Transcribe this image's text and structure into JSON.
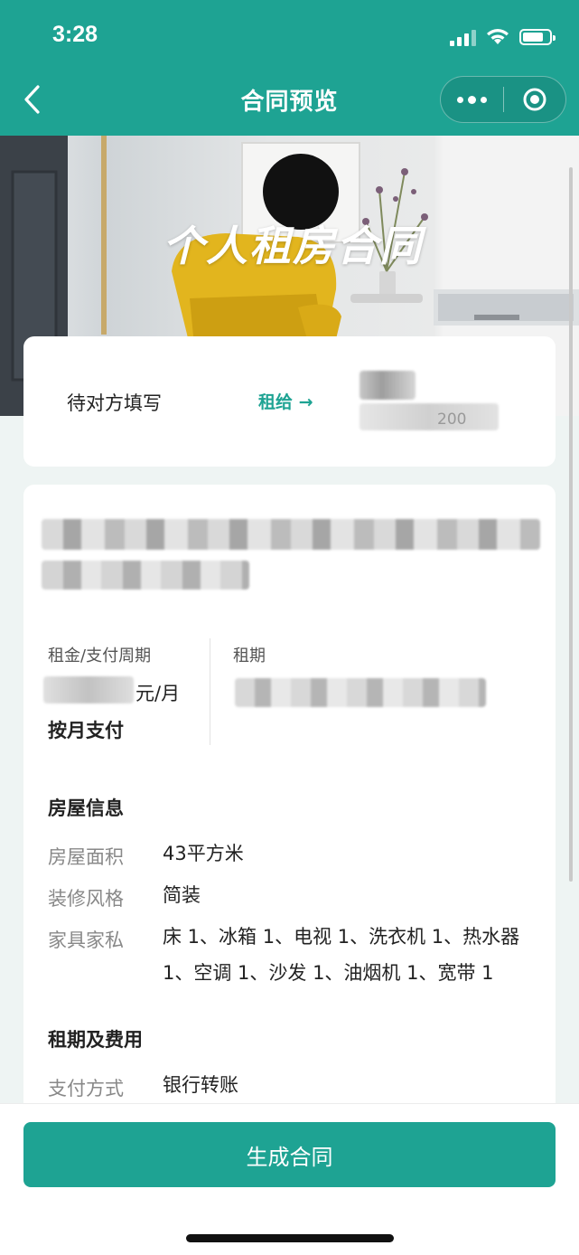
{
  "status_bar": {
    "time": "3:28"
  },
  "nav": {
    "title": "合同预览"
  },
  "hero": {
    "title": "个人租房合同"
  },
  "status_card": {
    "pending_text": "待对方填写",
    "lend_link": "租给 →",
    "party_partial": "200"
  },
  "rent": {
    "rent_label": "租金/支付周期",
    "rent_unit": "元/月",
    "pay_cycle": "按月支付",
    "term_label": "租期"
  },
  "house": {
    "section_title": "房屋信息",
    "rows": [
      {
        "label": "房屋面积",
        "value": "43平方米"
      },
      {
        "label": "装修风格",
        "value": "简装"
      },
      {
        "label": "家具家私",
        "value": "床 1、冰箱 1、电视 1、洗衣机 1、热水器 1、空调 1、沙发 1、油烟机 1、宽带 1"
      }
    ]
  },
  "fees": {
    "section_title": "租期及费用",
    "rows": [
      {
        "label": "支付方式",
        "value": "银行转账"
      }
    ]
  },
  "action": {
    "generate_label": "生成合同"
  },
  "colors": {
    "brand": "#1ea393"
  }
}
